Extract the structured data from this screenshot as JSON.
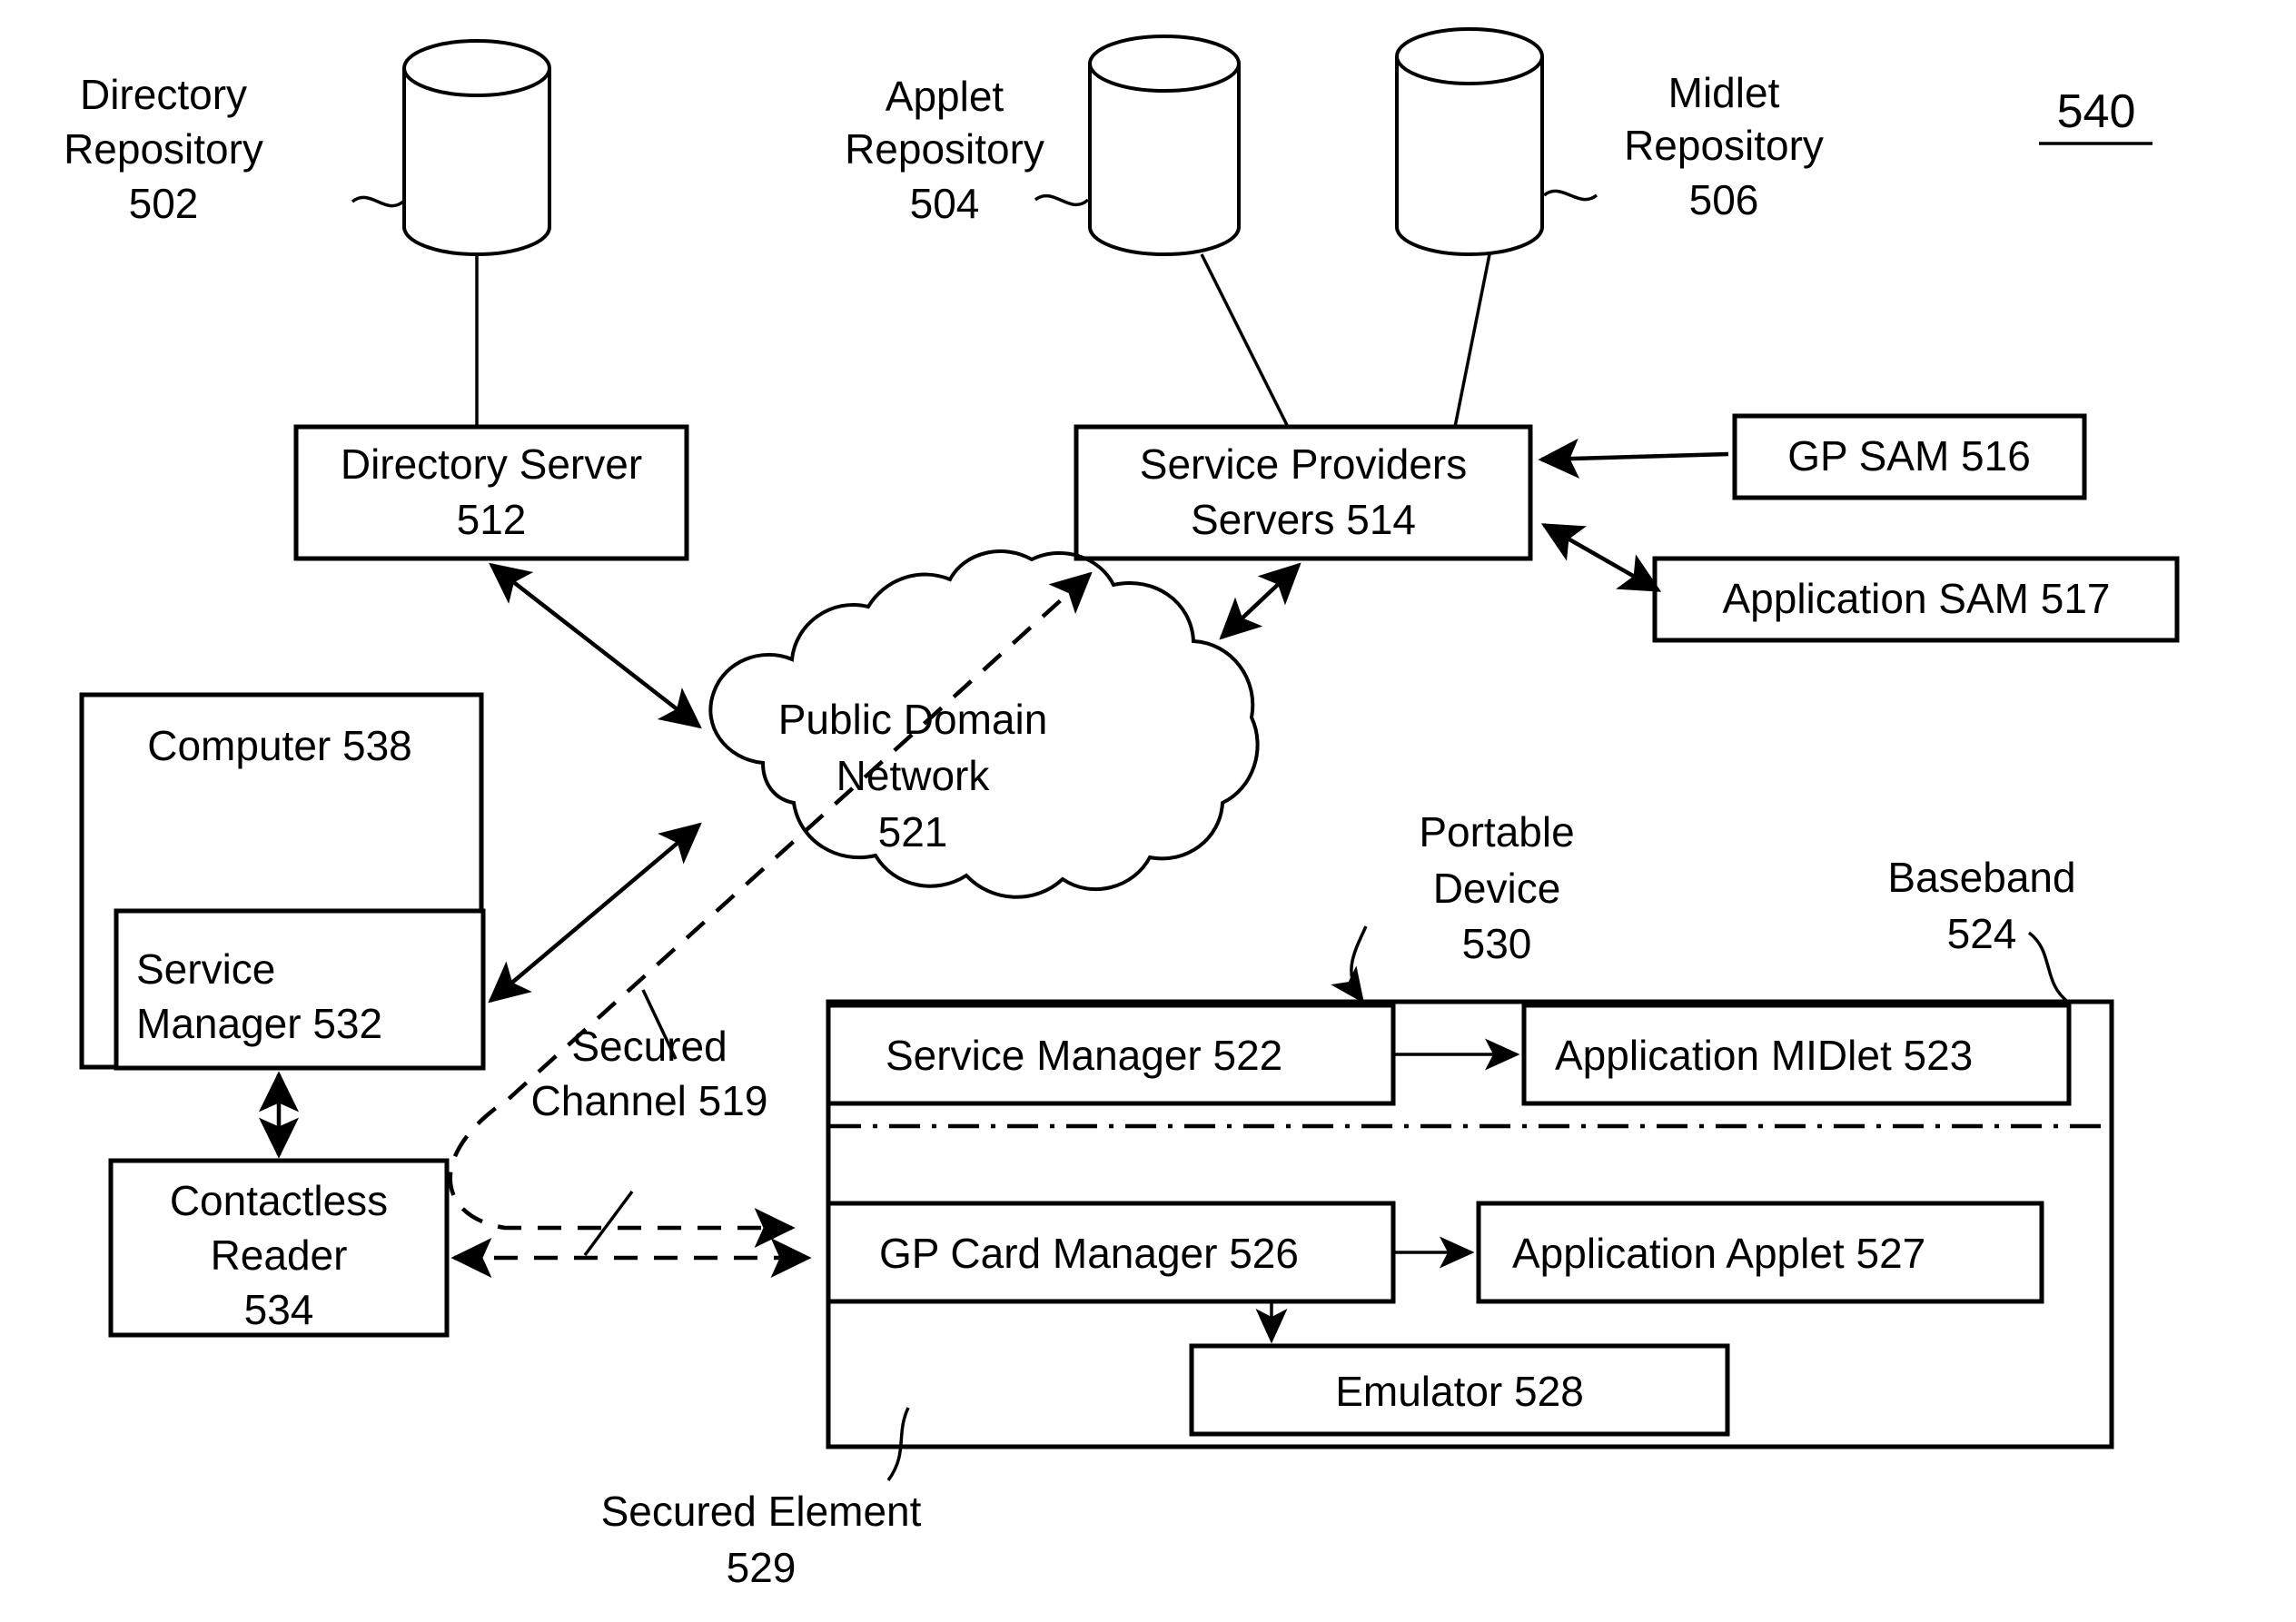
{
  "figure": {
    "number": "540",
    "number_underlined": true
  },
  "repositories": [
    {
      "name": "directory-repository",
      "line1": "Directory",
      "line2": "Repository",
      "ref": "502"
    },
    {
      "name": "applet-repository",
      "line1": "Applet",
      "line2": "Repository",
      "ref": "504"
    },
    {
      "name": "midlet-repository",
      "line1": "Midlet",
      "line2": "Repository",
      "ref": "506"
    }
  ],
  "servers": {
    "directory_server": {
      "line1": "Directory Server",
      "line2": "512"
    },
    "service_providers": {
      "line1": "Service Providers",
      "line2": "Servers 514"
    }
  },
  "sam_modules": [
    {
      "name": "gp-sam",
      "label": "GP SAM 516"
    },
    {
      "name": "application-sam",
      "label": "Application SAM 517"
    }
  ],
  "network": {
    "line1": "Public Domain",
    "line2": "Network",
    "line3": "521"
  },
  "computer": {
    "title": "Computer 538",
    "service_manager": {
      "line1": "Service",
      "line2": "Manager 532"
    },
    "contactless_reader": {
      "line1": "Contactless",
      "line2": "Reader",
      "line3": "534"
    }
  },
  "secured_channel": {
    "line1": "Secured",
    "line2": "Channel 519"
  },
  "portable_device": {
    "callout": {
      "line1": "Portable",
      "line2": "Device",
      "line3": "530"
    },
    "baseband_callout": {
      "line1": "Baseband",
      "line2": "524"
    },
    "secured_element_callout": {
      "line1": "Secured Element",
      "line2": "529"
    },
    "upper_blocks": [
      {
        "name": "service-manager-522",
        "label": "Service Manager 522"
      },
      {
        "name": "application-midlet-523",
        "label": "Application MIDlet 523"
      }
    ],
    "lower_blocks": [
      {
        "name": "gp-card-manager-526",
        "label": "GP Card Manager 526"
      },
      {
        "name": "application-applet-527",
        "label": "Application Applet 527"
      },
      {
        "name": "emulator-528",
        "label": "Emulator 528"
      }
    ]
  },
  "colors": {
    "stroke": "#000000",
    "background": "#ffffff"
  }
}
